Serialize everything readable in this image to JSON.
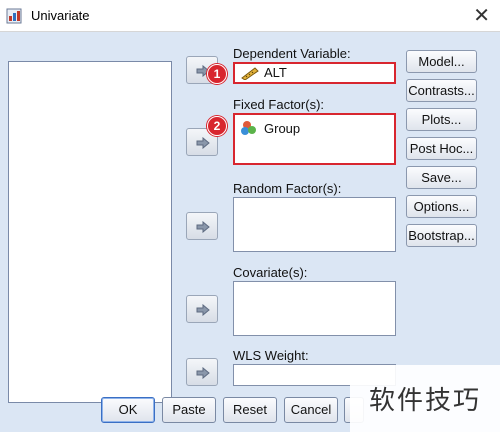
{
  "window": {
    "title": "Univariate",
    "close_glyph": "✕"
  },
  "fields": {
    "dependent": {
      "label": "Dependent Variable:",
      "value": "ALT",
      "icon": "ruler-scale-icon",
      "badge": "1"
    },
    "fixed": {
      "label": "Fixed Factor(s):",
      "value": "Group",
      "icon": "nominal-circles-icon",
      "badge": "2"
    },
    "random": {
      "label": "Random Factor(s):"
    },
    "covariate": {
      "label": "Covariate(s):"
    },
    "wls": {
      "label": "WLS Weight:"
    }
  },
  "side_buttons": [
    "Model...",
    "Contrasts...",
    "Plots...",
    "Post Hoc...",
    "Save...",
    "Options...",
    "Bootstrap..."
  ],
  "bottom_buttons": [
    "OK",
    "Paste",
    "Reset",
    "Cancel"
  ],
  "watermark": "软件技巧",
  "colors": {
    "highlight_red": "#d8262f",
    "dialog_bg": "#dbe6f4"
  }
}
